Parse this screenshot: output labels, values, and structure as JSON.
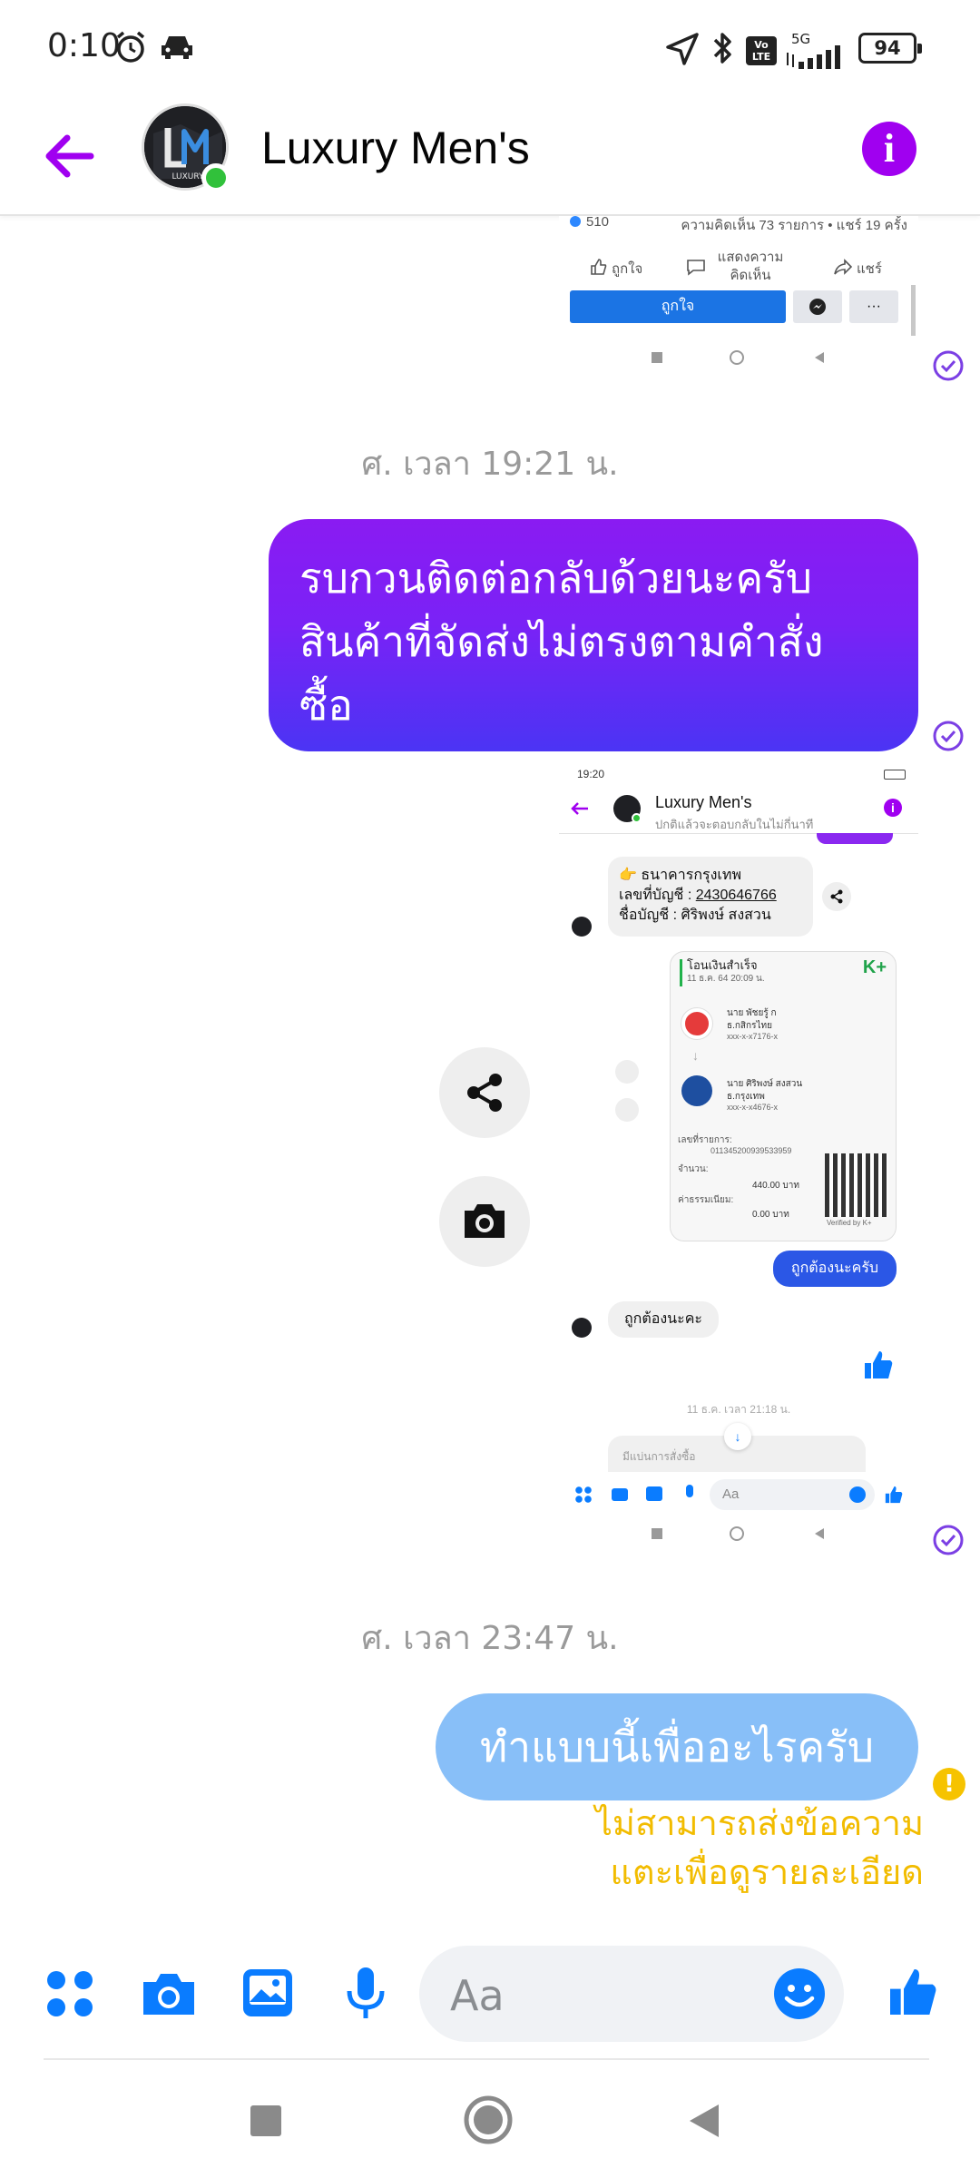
{
  "status": {
    "time": "0:10",
    "battery": "94",
    "network": "5G",
    "volte": "Vo LTE"
  },
  "header": {
    "title": "Luxury Men's",
    "avatar_text": "LUXURY"
  },
  "shot1": {
    "likes": "510",
    "meta": "ความคิดเห็น 73 รายการ • แชร์ 19 ครั้ง",
    "like_label": "ถูกใจ",
    "comment_label": "แสดงความคิดเห็น",
    "share_label": "แชร์",
    "like_button": "ถูกใจ",
    "more": "···"
  },
  "timestamp1": "ศ. เวลา 19:21 น.",
  "message1": {
    "line1": "รบกวนติดต่อกลับด้วยนะครับ",
    "line2": "สินค้าที่จัดส่งไม่ตรงตามคำสั่ง",
    "line3": "ซื้อ"
  },
  "shot2": {
    "time": "19:20",
    "title": "Luxury Men's",
    "subtitle": "ปกติแล้วจะตอบกลับในไม่กี่นาที",
    "bank_line1": "👉 ธนาคารกรุงเทพ",
    "bank_line2_label": "เลขที่บัญชี : ",
    "bank_line2_value": "2430646766",
    "bank_line3": "ชื่อบัญชี : ศิริพงษ์ สงสวน",
    "slip_title": "โอนเงินสำเร็จ",
    "slip_date": "11 ธ.ค. 64  20:09 น.",
    "slip_brand": "K+",
    "from_name": "นาย พัชยรู้ ก",
    "from_bank": "ธ.กสิกรไทย",
    "from_acct": "xxx-x-x7176-x",
    "to_name": "นาย ศิริพงษ์ สงสวน",
    "to_bank": "ธ.กรุงเทพ",
    "to_acct": "xxx-x-x4676-x",
    "ref_label": "เลขที่รายการ:",
    "ref_value": "011345200939533959",
    "amount_label": "จำนวน:",
    "amount_value": "440.00 บาท",
    "fee_label": "ค่าธรรมเนียม:",
    "fee_value": "0.00 บาท",
    "verified": "Verified by K+",
    "sent_reply": "ถูกต้องนะครับ",
    "recv_reply": "ถูกต้องนะคะ",
    "timestamp": "11 ธ.ค. เวลา 21:18 น.",
    "preview": "มีแบ่นการสั่งซื้อ",
    "input_placeholder": "Aa"
  },
  "timestamp2": "ศ. เวลา 23:47 น.",
  "message2": {
    "text": "ทำแบบนี้เพื่ออะไรครับ"
  },
  "error": {
    "line1": "ไม่สามารถส่งข้อความ",
    "line2": "แตะเพื่อดูรายละเอียด",
    "icon": "!"
  },
  "composer": {
    "placeholder": "Aa"
  },
  "colors": {
    "accent": "#a000f0",
    "messenger_blue": "#0a7cff",
    "failed_bubble": "#88bff8",
    "error_text": "#f2bc00"
  }
}
